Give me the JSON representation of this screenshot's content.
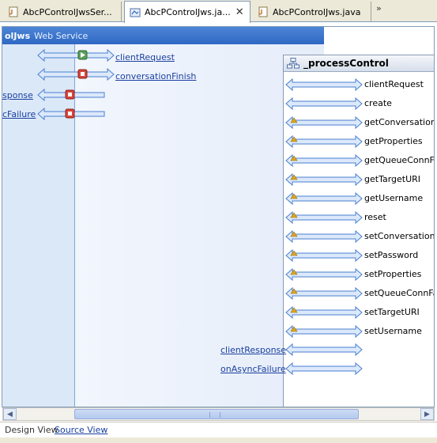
{
  "tabs": [
    {
      "label": "AbcPControlJwsSer...",
      "icon": "java-file-icon",
      "active": false
    },
    {
      "label": "AbcPControlJws.ja...",
      "icon": "design-view-icon",
      "active": true,
      "close": "✕"
    },
    {
      "label": "AbcPControlJws.java",
      "icon": "java-file-icon",
      "active": false
    }
  ],
  "overflow": "»",
  "web_service": {
    "name": "olJws",
    "type_label": "Web Service",
    "methods": [
      {
        "label": "clientRequest",
        "kind": "start"
      },
      {
        "label": "conversationFinish",
        "kind": "finish"
      }
    ],
    "callbacks": [
      {
        "label": "sponse",
        "kind": "finish"
      },
      {
        "label": "cFailure",
        "kind": "finish"
      }
    ]
  },
  "process_control": {
    "title": "_processControl",
    "operations": [
      {
        "label": "clientRequest",
        "warn": false
      },
      {
        "label": "create",
        "warn": false
      },
      {
        "label": "getConversationID",
        "warn": true
      },
      {
        "label": "getProperties",
        "warn": true
      },
      {
        "label": "getQueueConnFac",
        "warn": true
      },
      {
        "label": "getTargetURI",
        "warn": true
      },
      {
        "label": "getUsername",
        "warn": true
      },
      {
        "label": "reset",
        "warn": true
      },
      {
        "label": "setConversationID",
        "warn": true
      },
      {
        "label": "setPassword",
        "warn": true
      },
      {
        "label": "setProperties",
        "warn": true
      },
      {
        "label": "setQueueConnFac",
        "warn": true
      },
      {
        "label": "setTargetURI",
        "warn": true
      },
      {
        "label": "setUsername",
        "warn": true
      }
    ],
    "callbacks": [
      {
        "label": "clientResponse"
      },
      {
        "label": "onAsyncFailure"
      }
    ]
  },
  "view_tabs": {
    "design": "Design View",
    "source": "Source View"
  },
  "colors": {
    "accent": "#2f68c3",
    "link": "#1a3fa0",
    "arrow_fill": "#dce9fb",
    "arrow_stroke": "#4a7fd0",
    "start_marker": "#5aa05a",
    "finish_marker": "#d9443a",
    "warn_marker": "#e0a81d"
  }
}
